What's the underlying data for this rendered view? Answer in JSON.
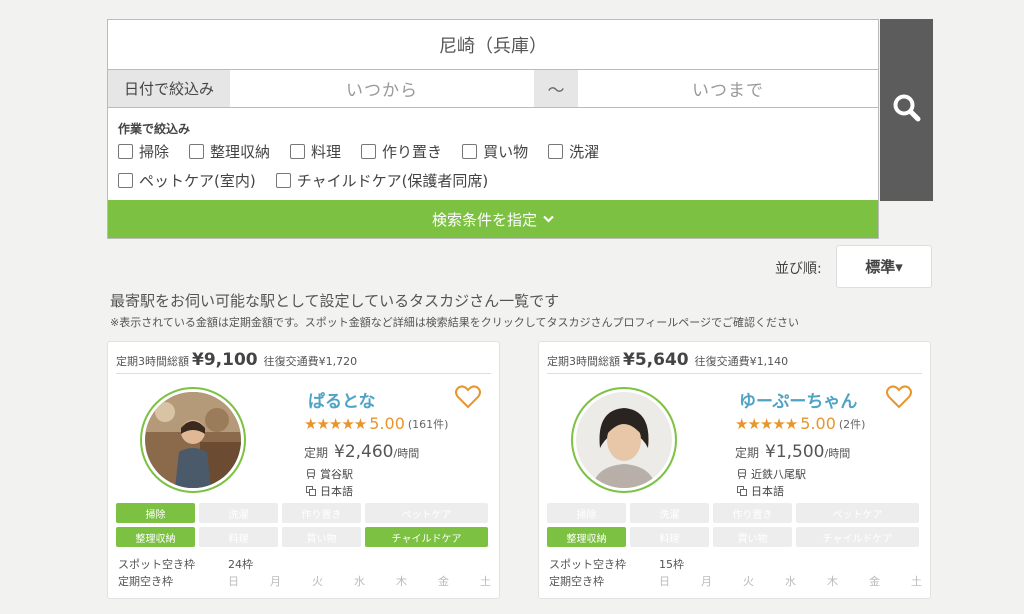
{
  "search": {
    "station": "尼崎（兵庫）",
    "date_label": "日付で絞込み",
    "date_from_placeholder": "いつから",
    "date_tilde": "～",
    "date_to_placeholder": "いつまで",
    "task_filter_title": "作業で絞込み",
    "tasks_row1": [
      "掃除",
      "整理収納",
      "料理",
      "作り置き",
      "買い物",
      "洗濯"
    ],
    "tasks_row2": [
      "ペットケア(室内)",
      "チャイルドケア(保護者同席)"
    ],
    "toggle_label": "検索条件を指定",
    "accent_color": "#7cc142"
  },
  "sort": {
    "label": "並び順:",
    "value": "標準▾"
  },
  "list": {
    "heading": "最寄駅をお伺い可能な駅として設定しているタスカジさん一覧です",
    "note": "※表示されている金額は定期金額です。スポット金額など詳細は検索結果をクリックしてタスカジさんプロフィールページでご確認ください"
  },
  "cards": [
    {
      "total_label": "定期3時間総額",
      "total": "¥9,100",
      "fare": "往復交通費¥1,720",
      "name": "ぱるとな",
      "stars": "★★★★★",
      "score": "5.00",
      "reviews": "(161件)",
      "price_label": "定期",
      "price": "¥2,460",
      "price_unit": "/時間",
      "station": "賞谷駅",
      "language": "日本語",
      "tags": [
        {
          "label": "掃除",
          "on": true
        },
        {
          "label": "洗濯",
          "on": false
        },
        {
          "label": "作り置き",
          "on": false
        },
        {
          "label": "ペットケア",
          "on": false
        },
        {
          "label": "整理収納",
          "on": true
        },
        {
          "label": "料理",
          "on": false
        },
        {
          "label": "買い物",
          "on": false
        },
        {
          "label": "チャイルドケア",
          "on": true
        }
      ],
      "spot_label": "スポット空き枠",
      "spot_value": "24枠",
      "fixed_label": "定期空き枠",
      "days": [
        "日",
        "月",
        "火",
        "水",
        "木",
        "金",
        "土"
      ]
    },
    {
      "total_label": "定期3時間総額",
      "total": "¥5,640",
      "fare": "往復交通費¥1,140",
      "name": "ゆーぷーちゃん",
      "stars": "★★★★★",
      "score": "5.00",
      "reviews": "(2件)",
      "price_label": "定期",
      "price": "¥1,500",
      "price_unit": "/時間",
      "station": "近鉄八尾駅",
      "language": "日本語",
      "tags": [
        {
          "label": "掃除",
          "on": false
        },
        {
          "label": "洗濯",
          "on": false
        },
        {
          "label": "作り置き",
          "on": false
        },
        {
          "label": "ペットケア",
          "on": false
        },
        {
          "label": "整理収納",
          "on": true
        },
        {
          "label": "料理",
          "on": false
        },
        {
          "label": "買い物",
          "on": false
        },
        {
          "label": "チャイルドケア",
          "on": false
        }
      ],
      "spot_label": "スポット空き枠",
      "spot_value": "15枠",
      "fixed_label": "定期空き枠",
      "days": [
        "日",
        "月",
        "火",
        "水",
        "木",
        "金",
        "土"
      ]
    }
  ]
}
